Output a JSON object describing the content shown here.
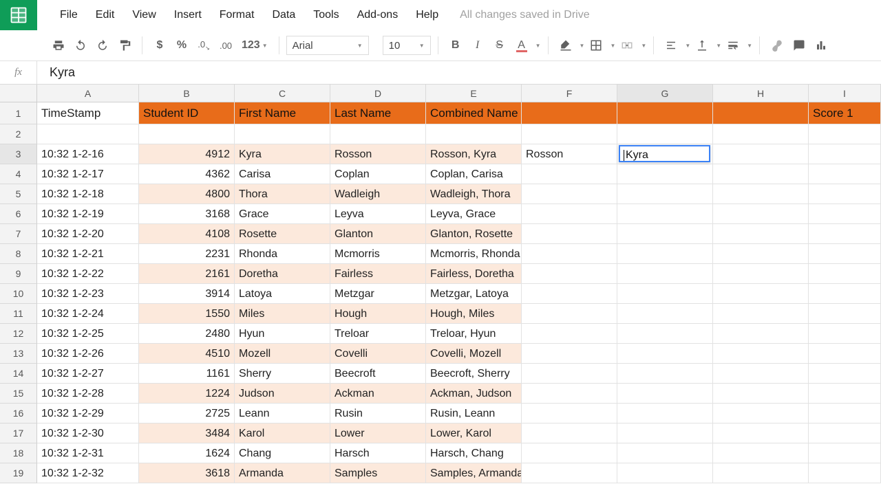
{
  "menu": {
    "items": [
      "File",
      "Edit",
      "View",
      "Insert",
      "Format",
      "Data",
      "Tools",
      "Add-ons",
      "Help"
    ],
    "status": "All changes saved in Drive"
  },
  "toolbar": {
    "currency": "$",
    "percent": "%",
    "num123": "123",
    "font": "Arial",
    "size": "10",
    "bold": "B",
    "italic": "I",
    "textcolor": "A"
  },
  "formula": {
    "fx": "fx",
    "value": "Kyra"
  },
  "columns": [
    "A",
    "B",
    "C",
    "D",
    "E",
    "F",
    "G",
    "H",
    "I"
  ],
  "selected_col_index": 6,
  "selected_row_index": 2,
  "active_cell": {
    "col": "G",
    "row": 3,
    "value": "Kyra"
  },
  "header_row": {
    "cells": [
      "TimeStamp",
      "Student ID",
      "First Name",
      "Last Name",
      "Combined Name",
      "",
      "",
      "",
      "Score 1"
    ],
    "orange_cols": [
      1,
      2,
      3,
      4,
      5,
      6,
      7,
      8
    ]
  },
  "shade_cols": [
    1,
    2,
    3,
    4
  ],
  "rows": [
    {
      "n": 2,
      "cells": [
        "",
        "",
        "",
        "",
        "",
        "",
        "",
        "",
        ""
      ]
    },
    {
      "n": 3,
      "cells": [
        "10:32 1-2-16",
        "4912",
        "Kyra",
        "Rosson",
        "Rosson, Kyra",
        "Rosson",
        "|Kyra",
        "",
        ""
      ]
    },
    {
      "n": 4,
      "cells": [
        "10:32 1-2-17",
        "4362",
        "Carisa",
        "Coplan",
        "Coplan, Carisa",
        "",
        "",
        "",
        ""
      ]
    },
    {
      "n": 5,
      "cells": [
        "10:32 1-2-18",
        "4800",
        "Thora",
        "Wadleigh",
        "Wadleigh, Thora",
        "",
        "",
        "",
        ""
      ]
    },
    {
      "n": 6,
      "cells": [
        "10:32 1-2-19",
        "3168",
        "Grace",
        "Leyva",
        "Leyva, Grace",
        "",
        "",
        "",
        ""
      ]
    },
    {
      "n": 7,
      "cells": [
        "10:32 1-2-20",
        "4108",
        "Rosette",
        "Glanton",
        "Glanton, Rosette",
        "",
        "",
        "",
        ""
      ]
    },
    {
      "n": 8,
      "cells": [
        "10:32 1-2-21",
        "2231",
        "Rhonda",
        "Mcmorris",
        "Mcmorris, Rhonda",
        "",
        "",
        "",
        ""
      ]
    },
    {
      "n": 9,
      "cells": [
        "10:32 1-2-22",
        "2161",
        "Doretha",
        "Fairless",
        "Fairless, Doretha",
        "",
        "",
        "",
        ""
      ]
    },
    {
      "n": 10,
      "cells": [
        "10:32 1-2-23",
        "3914",
        "Latoya",
        "Metzgar",
        "Metzgar, Latoya",
        "",
        "",
        "",
        ""
      ]
    },
    {
      "n": 11,
      "cells": [
        "10:32 1-2-24",
        "1550",
        "Miles",
        "Hough",
        "Hough, Miles",
        "",
        "",
        "",
        ""
      ]
    },
    {
      "n": 12,
      "cells": [
        "10:32 1-2-25",
        "2480",
        "Hyun",
        "Treloar",
        "Treloar, Hyun",
        "",
        "",
        "",
        ""
      ]
    },
    {
      "n": 13,
      "cells": [
        "10:32 1-2-26",
        "4510",
        "Mozell",
        "Covelli",
        "Covelli, Mozell",
        "",
        "",
        "",
        ""
      ]
    },
    {
      "n": 14,
      "cells": [
        "10:32 1-2-27",
        "1161",
        "Sherry",
        "Beecroft",
        "Beecroft, Sherry",
        "",
        "",
        "",
        ""
      ]
    },
    {
      "n": 15,
      "cells": [
        "10:32 1-2-28",
        "1224",
        "Judson",
        "Ackman",
        "Ackman, Judson",
        "",
        "",
        "",
        ""
      ]
    },
    {
      "n": 16,
      "cells": [
        "10:32 1-2-29",
        "2725",
        "Leann",
        "Rusin",
        "Rusin, Leann",
        "",
        "",
        "",
        ""
      ]
    },
    {
      "n": 17,
      "cells": [
        "10:32 1-2-30",
        "3484",
        "Karol",
        "Lower",
        "Lower, Karol",
        "",
        "",
        "",
        ""
      ]
    },
    {
      "n": 18,
      "cells": [
        "10:32 1-2-31",
        "1624",
        "Chang",
        "Harsch",
        "Harsch, Chang",
        "",
        "",
        "",
        ""
      ]
    },
    {
      "n": 19,
      "cells": [
        "10:32 1-2-32",
        "3618",
        "Armanda",
        "Samples",
        "Samples, Armanda",
        "",
        "",
        "",
        ""
      ]
    }
  ]
}
